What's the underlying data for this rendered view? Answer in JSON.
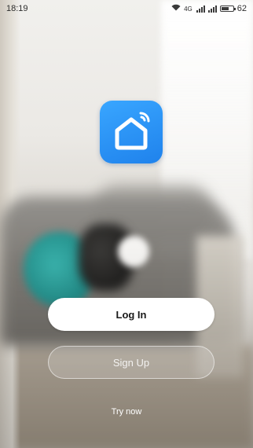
{
  "status_bar": {
    "time": "18:19",
    "network_label": "4G",
    "battery_percent": "62",
    "battery_level": 0.62
  },
  "app": {
    "icon": "smart-home-wifi-icon",
    "accent_color": "#2a91f5"
  },
  "buttons": {
    "login_label": "Log In",
    "signup_label": "Sign Up",
    "try_now_label": "Try now"
  },
  "icons": {
    "wifi": "wifi-icon",
    "signal": "cell-signal-icon",
    "battery": "battery-icon",
    "home": "house-icon"
  }
}
